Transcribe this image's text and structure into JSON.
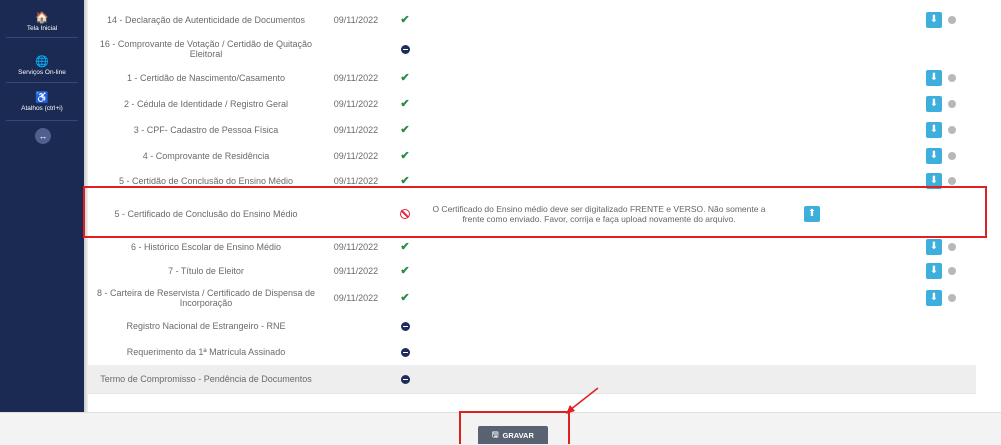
{
  "sidebar": {
    "items": [
      {
        "label": "Tela Inicial",
        "icon": "home-icon",
        "glyph": "🏠"
      },
      {
        "label": "Serviços On-line",
        "icon": "globe-icon",
        "glyph": "🌐"
      },
      {
        "label": "Atalhos (ctrl+i)",
        "icon": "accessibility-icon",
        "glyph": "♿"
      }
    ],
    "toggle_glyph": "↔"
  },
  "rows": [
    {
      "doc": "14 - Declaração de Autenticidade de Documentos",
      "date": "09/11/2022",
      "status": "ok",
      "actions": true
    },
    {
      "doc": "16 - Comprovante de Votação / Certidão de Quitação Eleitoral",
      "date": "",
      "status": "pending",
      "actions": false
    },
    {
      "doc": "1 - Certidão de Nascimento/Casamento",
      "date": "09/11/2022",
      "status": "ok",
      "actions": true
    },
    {
      "doc": "2 - Cédula de Identidade / Registro Geral",
      "date": "09/11/2022",
      "status": "ok",
      "actions": true
    },
    {
      "doc": "3 - CPF- Cadastro de Pessoa Física",
      "date": "09/11/2022",
      "status": "ok",
      "actions": true
    },
    {
      "doc": "4 - Comprovante de Residência",
      "date": "09/11/2022",
      "status": "ok",
      "actions": true
    },
    {
      "doc": "5 - Certidão de Conclusão do Ensino Médio",
      "date": "09/11/2022",
      "status": "ok",
      "actions": true
    },
    {
      "doc": "5 - Certificado de Conclusão do Ensino Médio",
      "date": "",
      "status": "rejected",
      "message": "O Certificado do Ensino médio deve ser digitalizado FRENTE e VERSO. Não somente a frente como enviado. Favor, corrija e faça upload novamente do arquivo.",
      "actions": false,
      "upload": true
    },
    {
      "doc": "6 - Histórico Escolar de Ensino Médio",
      "date": "09/11/2022",
      "status": "ok",
      "actions": true
    },
    {
      "doc": "7 - Título de Eleitor",
      "date": "09/11/2022",
      "status": "ok",
      "actions": true
    },
    {
      "doc": "8 - Carteira de Reservista / Certificado de Dispensa de Incorporação",
      "date": "09/11/2022",
      "status": "ok",
      "actions": true
    },
    {
      "doc": "Registro Nacional de Estrangeiro - RNE",
      "date": "",
      "status": "pending",
      "actions": false
    },
    {
      "doc": "Requerimento da 1ª Matrícula Assinado",
      "date": "",
      "status": "pending",
      "actions": false
    },
    {
      "doc": "Termo de Compromisso - Pendência de Documentos",
      "date": "",
      "status": "pending",
      "actions": false
    }
  ],
  "icons": {
    "ok": "✔",
    "download": "⬇",
    "upload": "⬆"
  },
  "footer": {
    "save_label": "GRAVAR",
    "save_icon": "🖫"
  },
  "colors": {
    "sidebar": "#1b2a52",
    "ok": "#2e8a43",
    "pending": "#1d2c5a",
    "rejected": "#e0243a",
    "action": "#3eaedc",
    "highlight": "#e02020"
  }
}
